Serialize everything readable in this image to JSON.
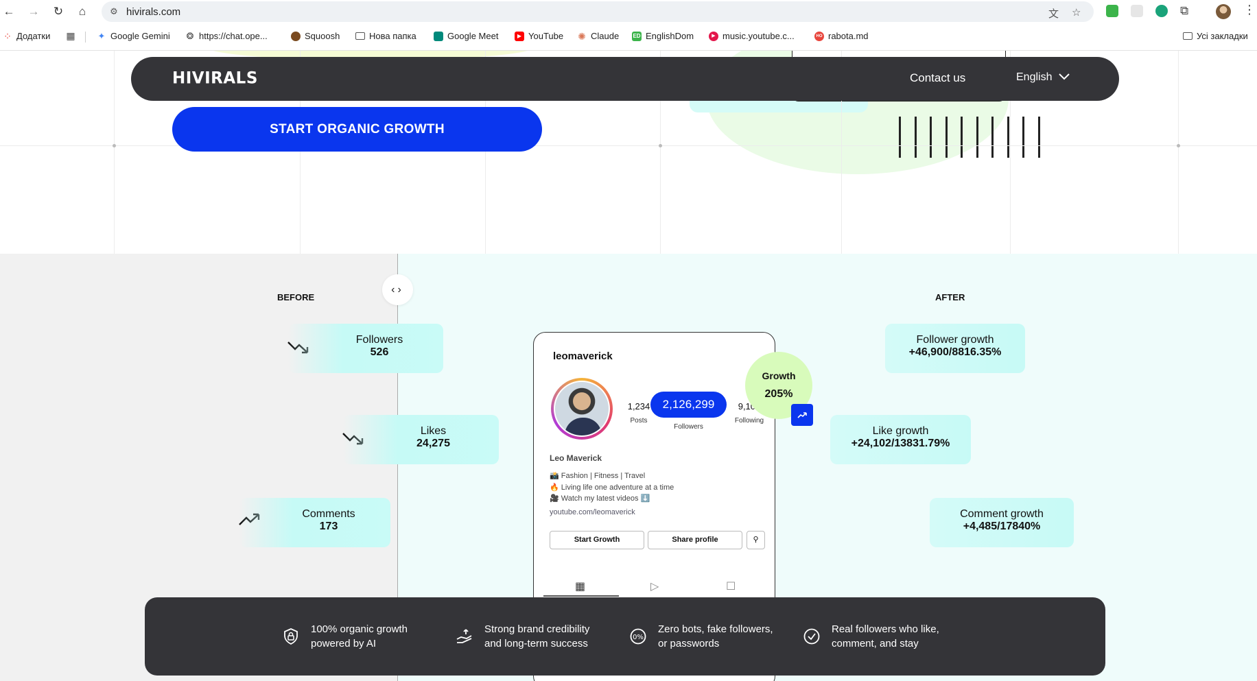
{
  "browser": {
    "url": "hivirals.com",
    "bookmarks": [
      {
        "label": "Додатки",
        "icon": "apps-grid-icon",
        "color": "#e8453c"
      },
      {
        "label": "Google Gemini",
        "icon": "gemini-icon",
        "color": "#4285f4"
      },
      {
        "label": "https://chat.ope...",
        "icon": "openai-icon",
        "color": "#555555"
      },
      {
        "label": "Squoosh",
        "icon": "squoosh-icon",
        "color": "#7a4a1f"
      },
      {
        "label": "Нова папка",
        "icon": "folder-icon",
        "color": "#666666"
      },
      {
        "label": "Google Meet",
        "icon": "meet-icon",
        "color": "#00897b"
      },
      {
        "label": "YouTube",
        "icon": "youtube-icon",
        "color": "#ff0000"
      },
      {
        "label": "Claude",
        "icon": "claude-icon",
        "color": "#d97757"
      },
      {
        "label": "EnglishDom",
        "icon": "englishdom-icon",
        "color": "#3cb44b"
      },
      {
        "label": "music.youtube.c...",
        "icon": "youtube-music-icon",
        "color": "#e3174b"
      },
      {
        "label": "rabota.md",
        "icon": "rabota-icon",
        "color": "#e8453c"
      }
    ],
    "all_bookmarks": "Усі закладки"
  },
  "header": {
    "logo": "HIVIRALS",
    "contact": "Contact us",
    "language": "English"
  },
  "hero": {
    "cta": "START ORGANIC GROWTH"
  },
  "comparison": {
    "before_label": "BEFORE",
    "after_label": "AFTER",
    "before": {
      "followers": {
        "label": "Followers",
        "value": "526"
      },
      "likes": {
        "label": "Likes",
        "value": "24,275"
      },
      "comments": {
        "label": "Comments",
        "value": "173"
      }
    },
    "after": {
      "followers": {
        "label": "Follower growth",
        "value": "+46,900/8816.35%"
      },
      "likes": {
        "label": "Like growth",
        "value": "+24,102/13831.79%"
      },
      "comments": {
        "label": "Comment growth",
        "value": "+4,485/17840%"
      }
    },
    "growth_badge": {
      "label": "Growth",
      "value": "205%"
    }
  },
  "profile": {
    "username": "leomaverick",
    "posts": {
      "value": "1,234",
      "label": "Posts"
    },
    "followers": {
      "value": "2,126,299",
      "label": "Followers"
    },
    "following": {
      "value": "9,101",
      "label": "Following"
    },
    "name": "Leo Maverick",
    "bio": [
      "📸 Fashion | Fitness | Travel",
      "🔥 Living life one adventure at a time",
      "🎥 Watch my latest videos ⬇️"
    ],
    "link": "youtube.com/leomaverick",
    "btn_start": "Start Growth",
    "btn_share": "Share profile"
  },
  "features": [
    {
      "line1": "100% organic growth",
      "line2": "powered by AI",
      "icon": "shield-icon"
    },
    {
      "line1": "Strong brand credibility",
      "line2": "and long-term success",
      "icon": "hand-rising-icon"
    },
    {
      "line1": "Zero bots, fake followers,",
      "line2": "or passwords",
      "icon": "zero-percent-icon"
    },
    {
      "line1": "Real followers who like,",
      "line2": "comment, and stay",
      "icon": "check-circle-icon"
    }
  ],
  "colors": {
    "primary_blue": "#0a36ee",
    "dark": "#343438",
    "before_bg": "#f1f1f1",
    "after_bg": "#effcfb",
    "badge_green": "#d8fbbb"
  }
}
